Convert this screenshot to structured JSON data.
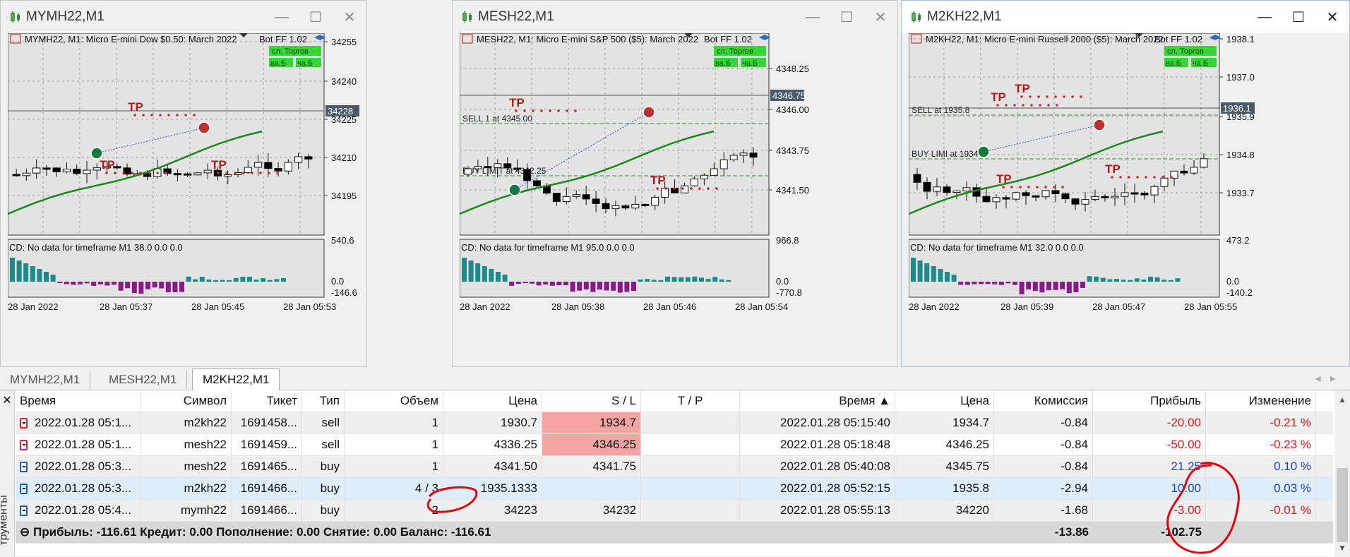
{
  "windows": [
    {
      "title": "MYMH22,M1",
      "chart_caption": "MYMH22, M1:  Micro E-mini Dow $0.50: March 2022",
      "bot": "Bot FF 1.02",
      "btn_trade": "сл. Торгов",
      "btn_a": "ва.Б",
      "btn_b": "ча.Б",
      "prices": [
        "34255",
        "34240",
        "34225",
        "34210",
        "34195"
      ],
      "current_price": "34228",
      "level_labels": [],
      "indicator": "CD: No data for timeframe M1 38.0 0.0 0.0",
      "ind_scale": [
        "540.6",
        "0.0",
        "-146.6"
      ],
      "times": [
        "28 Jan 2022",
        "28 Jan 05:37",
        "28 Jan 05:45",
        "28 Jan 05:53"
      ],
      "tp_label": "TP"
    },
    {
      "title": "MESH22,M1",
      "chart_caption": "MESH22, M1:  Micro E-mini S&P 500 ($5): March 2022",
      "bot": "Bot FF 1.02",
      "btn_trade": "сл. Торгов",
      "btn_a": "ва.Б",
      "btn_b": "ча.Б",
      "prices": [
        "4348.25",
        "4346.00",
        "4343.75",
        "4341.50"
      ],
      "current_price": "4346.75",
      "level_labels": [
        "SELL 1 at 4345.00",
        "BUY LIMIT    at 4342.25"
      ],
      "indicator": "CD: No data for timeframe M1 95.0 0.0 0.0",
      "ind_scale": [
        "966.8",
        "0.0",
        "-770.8"
      ],
      "times": [
        "28 Jan 2022",
        "28 Jan 05:38",
        "28 Jan 05:46",
        "28 Jan 05:54"
      ],
      "tp_label": "TP"
    },
    {
      "title": "M2KH22,M1",
      "chart_caption": "M2KH22, M1:  Micro E-mini Russell 2000 ($5): March 2022",
      "bot": "Bot FF 1.02",
      "btn_trade": "сл. Торгов",
      "btn_a": "ва.Б",
      "btn_b": "ча.Б",
      "prices": [
        "1938.1",
        "1937.0",
        "1935.9",
        "1934.8",
        "1933.7"
      ],
      "current_price": "1936.1",
      "level_labels": [
        "SELL    at 1935.8",
        "BUY LIMI    at 1934.5"
      ],
      "indicator": "CD: No data for timeframe M1 32.0 0.0 0.0",
      "ind_scale": [
        "473.2",
        "0.0",
        "-140.2"
      ],
      "times": [
        "28 Jan 2022",
        "28 Jan 05:39",
        "28 Jan 05:47",
        "28 Jan 05:55"
      ],
      "tp_label": "TP"
    }
  ],
  "tabs": [
    "MYMH22,M1",
    "MESH22,M1",
    "M2KH22,M1"
  ],
  "toolbox_label": "трументы",
  "table": {
    "headers": [
      "Время",
      "Символ",
      "Тикет",
      "Тип",
      "Объем",
      "Цена",
      "S / L",
      "T / P",
      "Время",
      "Цена",
      "Комиссия",
      "Прибыль",
      "Изменение"
    ],
    "rows": [
      {
        "time": "2022.01.28 05:1...",
        "symbol": "m2kh22",
        "ticket": "1691458...",
        "type": "sell",
        "volume": "1",
        "price": "1930.7",
        "sl": "1934.7",
        "tp": "",
        "close_time": "2022.01.28 05:15:40",
        "close_price": "1934.7",
        "commission": "-0.84",
        "profit": "-20.00",
        "change": "-0.21 %"
      },
      {
        "time": "2022.01.28 05:1...",
        "symbol": "mesh22",
        "ticket": "1691459...",
        "type": "sell",
        "volume": "1",
        "price": "4336.25",
        "sl": "4346.25",
        "tp": "",
        "close_time": "2022.01.28 05:18:48",
        "close_price": "4346.25",
        "commission": "-0.84",
        "profit": "-50.00",
        "change": "-0.23 %"
      },
      {
        "time": "2022.01.28 05:3...",
        "symbol": "mesh22",
        "ticket": "1691465...",
        "type": "buy",
        "volume": "1",
        "price": "4341.50",
        "sl": "4341.75",
        "tp": "",
        "close_time": "2022.01.28 05:40:08",
        "close_price": "4345.75",
        "commission": "-0.84",
        "profit": "21.25",
        "change": "0.10 %"
      },
      {
        "time": "2022.01.28 05:3...",
        "symbol": "m2kh22",
        "ticket": "1691466...",
        "type": "buy",
        "volume": "4 / 3",
        "price": "1935.1333",
        "sl": "",
        "tp": "",
        "close_time": "2022.01.28 05:52:15",
        "close_price": "1935.8",
        "commission": "-2.94",
        "profit": "10.00",
        "change": "0.03 %"
      },
      {
        "time": "2022.01.28 05:4...",
        "symbol": "mymh22",
        "ticket": "1691466...",
        "type": "buy",
        "volume": "2",
        "price": "34223",
        "sl": "34232",
        "tp": "",
        "close_time": "2022.01.28 05:55:13",
        "close_price": "34220",
        "commission": "-1.68",
        "profit": "-3.00",
        "change": "-0.01 %"
      }
    ],
    "summary": "Прибыль: -116.61  Кредит: 0.00  Пополнение: 0.00  Снятие: 0.00  Баланс: -116.61",
    "total_commission": "-13.86",
    "total_profit": "-102.75"
  },
  "colors": {
    "loss": "#e0141a",
    "gain": "#1a3fd6",
    "sl_highlight": "#f5a3a3",
    "annotation": "#e3000f",
    "bull": "#ffffff",
    "bear": "#000000",
    "ma": "#1a8a1a",
    "osc_pos": "#1f8a8a",
    "osc_neg": "#8a1a8a"
  }
}
